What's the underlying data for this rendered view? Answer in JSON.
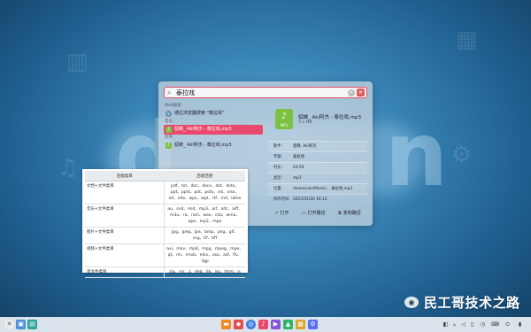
{
  "colors": {
    "accent": "#e8496c",
    "music": "#7cc142"
  },
  "launcher": {
    "search": {
      "value": "泰拉戏"
    },
    "groups": [
      {
        "title": "Web搜索",
        "items": [
          {
            "label": "通过浏览器搜索 \"泰拉戏\"",
            "icon": "browser-icon"
          }
        ]
      },
      {
        "title": "音乐",
        "items": [
          {
            "label": "貂蝉_ Aki阿杰 - 泰拉戏.mp3",
            "icon": "music-file-icon",
            "selected": true
          }
        ]
      },
      {
        "title": "文件",
        "items": [
          {
            "label": "貂蝉_ Aki阿杰 - 泰拉戏.mp3",
            "icon": "music-file-icon",
            "selected": false
          }
        ]
      }
    ],
    "detail": {
      "file_name": "貂蝉_ Aki阿杰 - 泰拉戏.mp3",
      "size": "9.2 MB",
      "icon_label": "MP3",
      "props": [
        {
          "key": "歌手:",
          "value": "貂蝉, Aki阿杰"
        },
        {
          "key": "专辑:",
          "value": "泰拉戏"
        },
        {
          "key": "时长:",
          "value": "03:59"
        },
        {
          "key": "类型:",
          "value": "mp3"
        },
        {
          "key": "位置:",
          "value": "/home/uos/Music/... 泰拉戏.mp3"
        },
        {
          "key": "修改时间:",
          "value": "2022/01/20 16:13"
        }
      ],
      "actions": [
        {
          "label": "打开",
          "icon": "open-icon"
        },
        {
          "label": "打开路径",
          "icon": "folder-icon"
        },
        {
          "label": "复制路径",
          "icon": "copy-icon"
        }
      ]
    }
  },
  "table": {
    "headers": [
      "后缀类目",
      "后缀范围"
    ],
    "rows": [
      {
        "category": "文档+文件类目",
        "range": "pdf、txt、doc、docx、dot、dotx、ppt、pptx、pot、potx、xls、xlsx、xlt、xltx、wps、wpt、rtf、md、latex"
      },
      {
        "category": "音乐+文件类目",
        "range": "au、snd、mid、mp3、aif、aifc、aiff、m3u、ra、ram、wav、cda、wma、ape、mp2、mpa"
      },
      {
        "category": "图片+文件类目",
        "range": "jpg、jpeg、jpe、bmp、png、gif、svg、tif、tiff"
      },
      {
        "category": "视频+文件类目",
        "range": "avi、mov、mp4、mpg、mpeg、mpe、qt、rm、rmvb、mkv、asx、asf、flv、3gp"
      },
      {
        "category": "单文件类目",
        "range": "zip、rar、z、deb、lib、iso、html、js"
      }
    ]
  },
  "watermark": {
    "text": "民工哥技术之路",
    "icon": "wechat-icon"
  }
}
